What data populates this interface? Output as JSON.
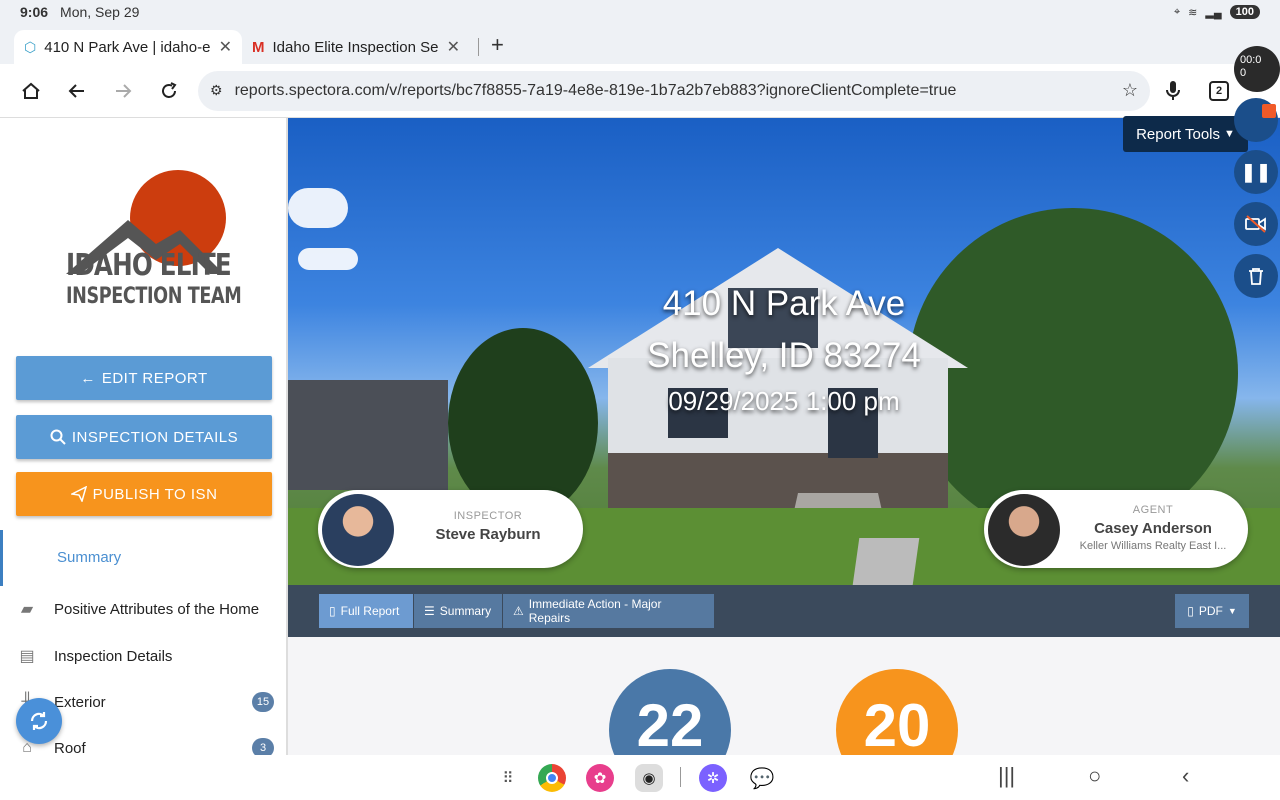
{
  "status": {
    "time": "9:06",
    "date": "Mon, Sep 29",
    "battery": "100"
  },
  "tabs": [
    {
      "title": "410 N Park Ave | idaho-el",
      "close": "✕"
    },
    {
      "title": "Idaho Elite Inspection Se",
      "close": "✕"
    }
  ],
  "newtab": "+",
  "omnibox": {
    "url": "reports.spectora.com/v/reports/bc7f8855-7a19-4e8e-819e-1b7a2b7eb883?ignoreClientComplete=true",
    "tab_count": "2"
  },
  "logo": {
    "line1": "IDAHO ELITE",
    "line2": "INSPECTION TEAM"
  },
  "sidebar": {
    "edit_report": "EDIT REPORT",
    "inspection_details_btn": "INSPECTION DETAILS",
    "publish": "PUBLISH TO ISN",
    "selected": "Summary",
    "items": [
      {
        "label": "Positive Attributes of the Home",
        "icon": "truck-icon",
        "count": ""
      },
      {
        "label": "Inspection Details",
        "icon": "document-icon",
        "count": ""
      },
      {
        "label": "Exterior",
        "icon": "fence-icon",
        "count": "15"
      },
      {
        "label": "Roof",
        "icon": "roof-icon",
        "count": "3"
      }
    ]
  },
  "hero": {
    "address_line1": "410 N Park Ave",
    "address_line2": "Shelley, ID 83274",
    "datetime": "09/29/2025 1:00 pm",
    "inspector_label": "INSPECTOR",
    "inspector_name": "Steve Rayburn",
    "agent_label": "AGENT",
    "agent_name": "Casey Anderson",
    "agent_company": "Keller Williams Realty East I..."
  },
  "report_tools": "Report Tools",
  "report_tabs": {
    "full": "Full Report",
    "summary": "Summary",
    "immediate": "Immediate Action - Major Repairs",
    "pdf": "PDF"
  },
  "counts": {
    "first": "22",
    "second": "20"
  },
  "recorder": {
    "timer": "00:0\n0"
  },
  "colors": {
    "blue_button": "#5b9bd5",
    "orange_button": "#f7941d",
    "circle_blue": "#4a78a8",
    "circle_orange": "#f7941d",
    "nav_dark": "#3b4a5c"
  }
}
